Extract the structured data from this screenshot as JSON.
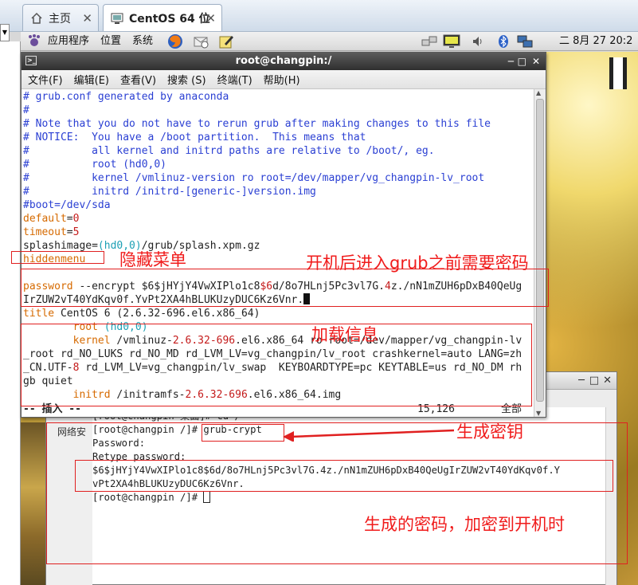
{
  "browser_tabs": [
    {
      "label": "主页",
      "icon": "home-icon"
    },
    {
      "label": "CentOS 64 位",
      "icon": "vm-icon"
    }
  ],
  "panel": {
    "menus": [
      "应用程序",
      "位置",
      "系统"
    ],
    "clock": "二  8月 27 20:2"
  },
  "terminal": {
    "title": "root@changpin:/",
    "menu": [
      "文件(F)",
      "编辑(E)",
      "查看(V)",
      "搜索 (S)",
      "终端(T)",
      "帮助(H)"
    ],
    "lines": [
      [
        {
          "t": "# grub.conf generated by anaconda",
          "c": "blue"
        }
      ],
      [
        {
          "t": "#",
          "c": "blue"
        }
      ],
      [
        {
          "t": "# Note that you do not have to rerun grub after making changes to this file",
          "c": "blue"
        }
      ],
      [
        {
          "t": "# NOTICE:  You have a /boot partition.  This means that",
          "c": "blue"
        }
      ],
      [
        {
          "t": "#          all kernel and initrd paths are relative to /boot/, eg.",
          "c": "blue"
        }
      ],
      [
        {
          "t": "#          root (hd0,0)",
          "c": "blue"
        }
      ],
      [
        {
          "t": "#          kernel /vmlinuz-version ro root=/dev/mapper/vg_changpin-lv_root",
          "c": "blue"
        }
      ],
      [
        {
          "t": "#          initrd /initrd-[generic-]version.img",
          "c": "blue"
        }
      ],
      [
        {
          "t": "#boot=/dev/sda",
          "c": "blue"
        }
      ],
      [
        {
          "t": "default",
          "c": "orange"
        },
        {
          "t": "=",
          "c": "dark"
        },
        {
          "t": "0",
          "c": "red"
        }
      ],
      [
        {
          "t": "timeout",
          "c": "orange"
        },
        {
          "t": "=",
          "c": "dark"
        },
        {
          "t": "5",
          "c": "red"
        }
      ],
      [
        {
          "t": "splashimage=",
          "c": "dark"
        },
        {
          "t": "(hd0,0)",
          "c": "cyan"
        },
        {
          "t": "/grub/splash.xpm.gz",
          "c": "dark"
        }
      ],
      [
        {
          "t": "hiddenmenu",
          "c": "orange"
        }
      ],
      [
        {
          "t": "",
          "c": "dark"
        }
      ],
      [
        {
          "t": "password",
          "c": "orange"
        },
        {
          "t": " --encrypt $6$jHYjY4VwXIPlo1c8",
          "c": "dark"
        },
        {
          "t": "$6",
          "c": "red"
        },
        {
          "t": "d/8o7HLnj5Pc3vl7G.",
          "c": "dark"
        },
        {
          "t": "4",
          "c": "red"
        },
        {
          "t": "z./nN1mZUH6pDxB40QeUg",
          "c": "dark"
        }
      ],
      [
        {
          "t": "IrZUW2vT40YdKqv0f.YvPt2XA4hBLUKUzyDUC6Kz6Vnr.",
          "c": "dark"
        },
        {
          "t": "CURSOR",
          "c": "cursor"
        }
      ],
      [
        {
          "t": "title",
          "c": "orange"
        },
        {
          "t": " CentOS 6 (2.6.32-696.el6.x86_64)",
          "c": "dark"
        }
      ],
      [
        {
          "t": "        root",
          "c": "orange"
        },
        {
          "t": " (hd0,0)",
          "c": "cyan"
        }
      ],
      [
        {
          "t": "        kernel",
          "c": "orange"
        },
        {
          "t": " /vmlinuz-",
          "c": "dark"
        },
        {
          "t": "2.6.32-696",
          "c": "red"
        },
        {
          "t": ".el6.x86_64 ",
          "c": "dark"
        },
        {
          "t": "ro",
          "c": "dark"
        },
        {
          "t": " root=/dev/mapper/vg_changpin-lv",
          "c": "dark"
        }
      ],
      [
        {
          "t": "_root rd_NO_LUKS rd_NO_MD rd_LVM_LV=vg_changpin/lv_root crashkernel=auto LANG=zh",
          "c": "dark"
        }
      ],
      [
        {
          "t": "_CN.UTF-",
          "c": "dark"
        },
        {
          "t": "8",
          "c": "red"
        },
        {
          "t": " rd_LVM_LV=vg_changpin/lv_swap  KEYBOARDTYPE=pc KEYTABLE=us rd_NO_DM rh",
          "c": "dark"
        }
      ],
      [
        {
          "t": "gb quiet",
          "c": "dark"
        }
      ],
      [
        {
          "t": "        initrd",
          "c": "orange"
        },
        {
          "t": " /initramfs-",
          "c": "dark"
        },
        {
          "t": "2.6.32-696",
          "c": "red"
        },
        {
          "t": ".el6.x86_64.img",
          "c": "dark"
        }
      ]
    ],
    "status_left": "-- 插入 --",
    "status_pos": "15,126",
    "status_right": "全部"
  },
  "terminal2": {
    "side_label": "网络安",
    "lines": [
      "[root@changpin 桌面]# cd /",
      "[root@changpin /]# grub-crypt",
      "Password:",
      "Retype password:",
      "$6$jHYjY4VwXIPlo1c8$6d/8o7HLnj5Pc3vl7G.4z./nN1mZUH6pDxB40QeUgIrZUW2vT40YdKqv0f.Y",
      "vPt2XA4hBLUKUzyDUC6Kz6Vnr.",
      "[root@changpin /]# "
    ]
  },
  "annotations": {
    "hidden_menu": "隐藏菜单",
    "password_before_grub": "开机后进入grub之前需要密码",
    "load_info": "加载信息",
    "generate_key": "生成密钥",
    "generated_password": "生成的密码，加密到开机时"
  },
  "colors": {
    "annotation": "#f01b1b",
    "comment": "#2a3fd3",
    "keyword": "#d66a00",
    "number": "#c41a1a",
    "paren": "#1b9fb4"
  }
}
